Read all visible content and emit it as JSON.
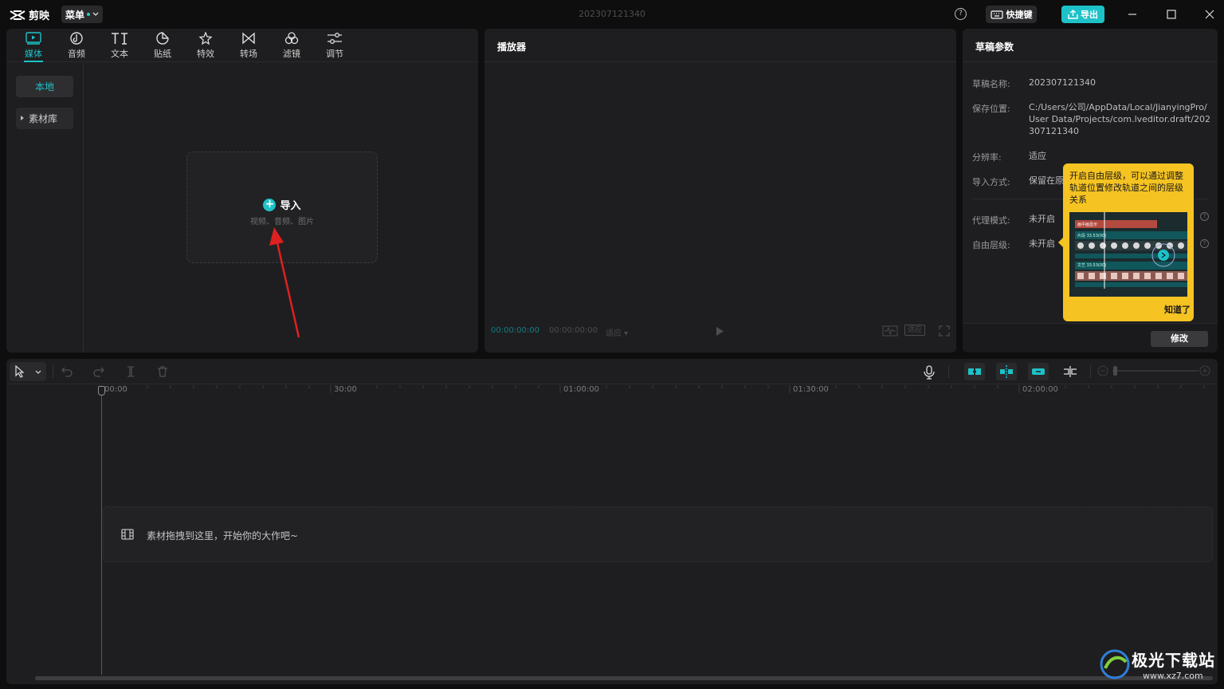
{
  "app": {
    "name": "剪映",
    "menu_label": "菜单",
    "document_title": "202307121340"
  },
  "titlebar": {
    "help_label": "?",
    "shortcut_label": "快捷键",
    "export_label": "导出"
  },
  "media_tabs": [
    {
      "label": "媒体",
      "icon": "media-icon",
      "active": true
    },
    {
      "label": "音频",
      "icon": "audio-icon"
    },
    {
      "label": "文本",
      "icon": "text-icon"
    },
    {
      "label": "贴纸",
      "icon": "sticker-icon"
    },
    {
      "label": "特效",
      "icon": "effects-icon"
    },
    {
      "label": "转场",
      "icon": "transition-icon"
    },
    {
      "label": "滤镜",
      "icon": "filter-icon"
    },
    {
      "label": "调节",
      "icon": "adjust-icon"
    }
  ],
  "media_sidebar": {
    "local": "本地",
    "library": "素材库"
  },
  "import": {
    "title": "导入",
    "subtitle": "视频、音频、图片"
  },
  "player": {
    "title": "播放器",
    "current_time": "00:00:00:00",
    "total_time": "00:00:00:00",
    "ratio": "适应",
    "fit": "适应"
  },
  "draft": {
    "title": "草稿参数",
    "name_label": "草稿名称:",
    "name_value": "202307121340",
    "path_label": "保存位置:",
    "path_value": "C:/Users/公司/AppData/Local/JianyingPro/User Data/Projects/com.lveditor.draft/202307121340",
    "resolution_label": "分辨率:",
    "resolution_value": "适应",
    "import_label": "导入方式:",
    "import_value": "保留在原",
    "proxy_label": "代理模式:",
    "proxy_value": "未开启",
    "layer_label": "自由层级:",
    "layer_value": "未开启",
    "modify_label": "修改"
  },
  "tooltip": {
    "text": "开启自由层级，可以通过调整轨道位置修改轨道之间的层级关系",
    "confirm": "知道了",
    "img_label1": "画中画显示",
    "img_label2": "片段  33.53(00)",
    "img_label3": "文艺  33.53(00)"
  },
  "timeline": {
    "ruler": [
      "00:00",
      "30:00",
      "01:00:00",
      "01:30:00",
      "02:00:00"
    ],
    "drop_text": "素材拖拽到这里，开始你的大作吧~"
  },
  "watermark": {
    "brand": "极光下载站",
    "url": "www.xz7.com"
  },
  "colors": {
    "accent": "#1dc2c8",
    "tooltip_bg": "#f5c322",
    "panel_bg": "#1e1e20",
    "annotation_arrow": "#e02020"
  }
}
